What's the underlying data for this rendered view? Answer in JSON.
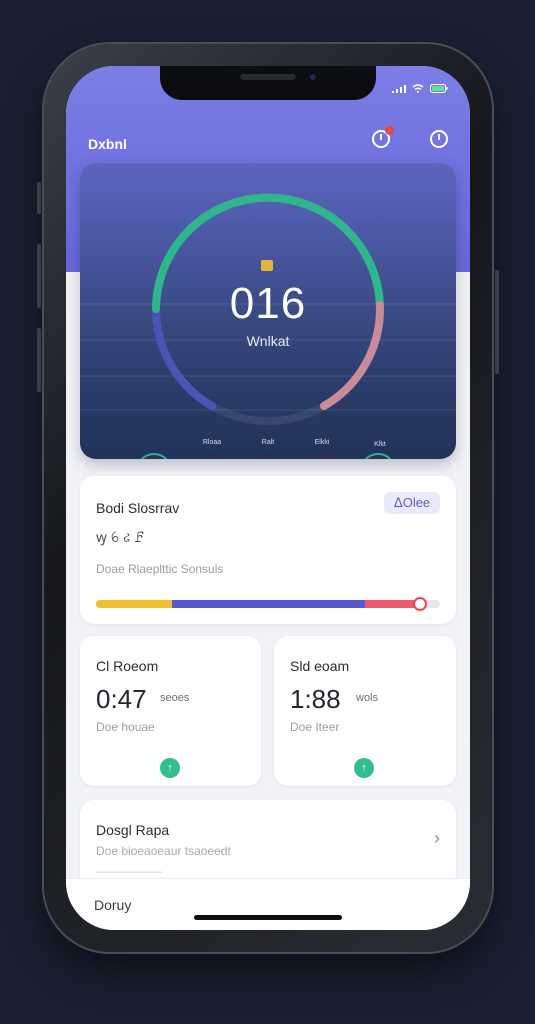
{
  "header": {
    "title": "Dxbnl",
    "icons": [
      "timer-icon",
      "clock-icon"
    ],
    "notification_color": "#e6474d"
  },
  "status_bar": {
    "icons": [
      "signal-icon",
      "wifi-icon",
      "battery-icon"
    ]
  },
  "gauge": {
    "value": "016",
    "label": "Wnlkat",
    "colors": {
      "primary": "#2fb68a",
      "secondary": "#4a56b5",
      "tertiary": "#c98a99"
    },
    "modes": [
      {
        "caption": "",
        "icon": "walk-icon"
      },
      {
        "caption": "Rloaa",
        "icon": "run-icon"
      },
      {
        "caption": "Ralt",
        "icon": "stretch-icon"
      },
      {
        "caption": "Elkki",
        "icon": "hike-icon"
      },
      {
        "caption": "Klkt",
        "icon": "stairs-icon"
      }
    ]
  },
  "progress_card": {
    "title": "Bodi Slosrrav",
    "chip": "ᐃOlee",
    "icons_text": "ꝡ ꕃ ઢ ꗓ",
    "subtitle": "Doae Rlaeplttic Sonsuls",
    "segments": [
      {
        "fraction": 0.22,
        "color": "#f2c02f"
      },
      {
        "fraction": 0.56,
        "color": "#5558cf"
      },
      {
        "fraction": 0.16,
        "color": "#ea5a6a"
      }
    ]
  },
  "stat_cards": [
    {
      "title": "Cl Roeom",
      "value": "0:47",
      "unit": "seoes",
      "subtitle": "Doe houae"
    },
    {
      "title": "Sld eoam",
      "value": "1:88",
      "unit": "wols",
      "subtitle": "Doe Iteer"
    }
  ],
  "list_card": {
    "title": "Dosgl Rapa",
    "subtitle": "Doe bioeaoeaur tsaoeedt",
    "faint": "——————"
  },
  "tabbar": {
    "label": "Doruy"
  }
}
